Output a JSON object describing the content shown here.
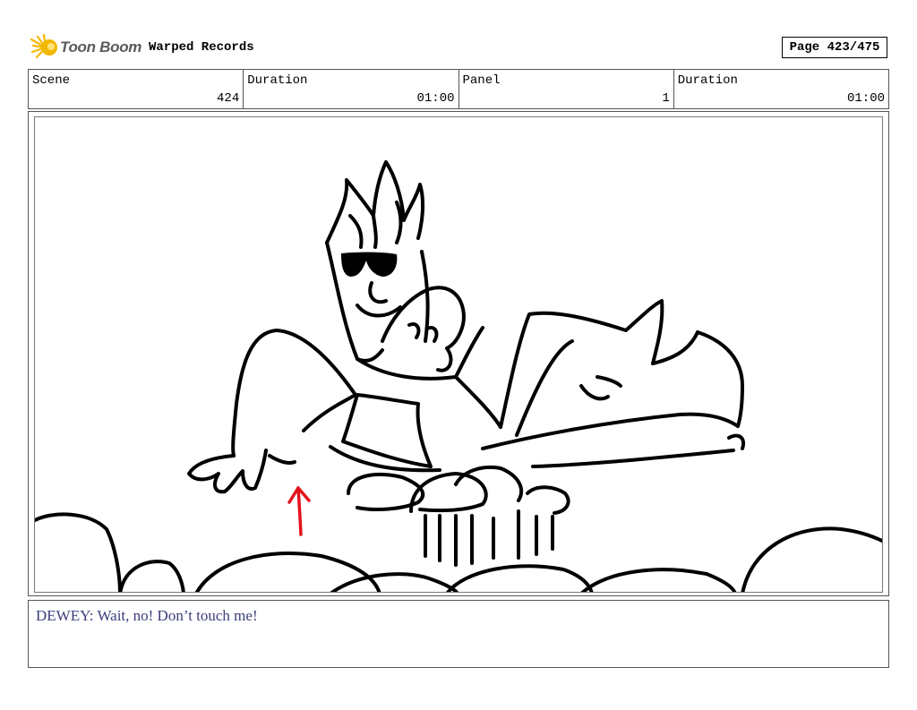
{
  "header": {
    "brand": "Toon Boom",
    "project": "Warped Records",
    "page": "Page 423/475"
  },
  "info": {
    "scene_label": "Scene",
    "scene_value": "424",
    "scene_duration_label": "Duration",
    "scene_duration_value": "01:00",
    "panel_label": "Panel",
    "panel_value": "1",
    "panel_duration_label": "Duration",
    "panel_duration_value": "01:00"
  },
  "dialogue": {
    "text": "DEWEY: Wait, no! Don’t touch me!"
  },
  "colors": {
    "logo_accent": "#f2b800",
    "dialogue_text": "#3b3f7a",
    "arrow": "#e3131b"
  }
}
